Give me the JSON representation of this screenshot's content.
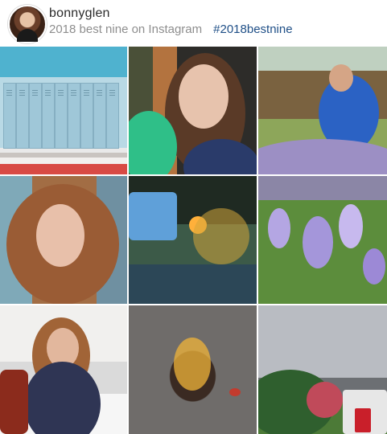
{
  "header": {
    "username": "bonnyglen",
    "caption": "2018 best nine on Instagram",
    "hashtag": "#2018bestnine"
  },
  "grid": {
    "tiles": [
      {
        "name": "photo-lockers"
      },
      {
        "name": "photo-selfie-with-child"
      },
      {
        "name": "photo-woman-crouching-in-crocus-field"
      },
      {
        "name": "photo-portrait"
      },
      {
        "name": "photo-evening-house-and-flowers"
      },
      {
        "name": "photo-purple-crocuses-closeup"
      },
      {
        "name": "photo-woman-at-table"
      },
      {
        "name": "photo-leaf-on-asphalt"
      },
      {
        "name": "photo-cloudy-street-with-trees"
      }
    ]
  }
}
